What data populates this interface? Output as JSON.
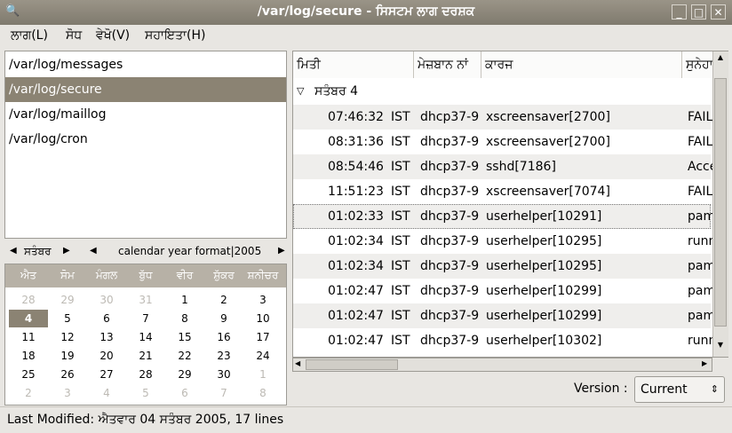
{
  "window": {
    "title": "/var/log/secure - ਸਿਸਟਮ ਲਾਗ ਦਰਸ਼ਕ"
  },
  "menu": [
    "ਲਾਗ(L)",
    "ਸੋਧ",
    "ਵੇਖੋ(V)",
    "ਸਹਾਇਤਾ(H)"
  ],
  "logs": [
    "/var/log/messages",
    "/var/log/secure",
    "/var/log/maillog",
    "/var/log/cron"
  ],
  "selected_log": "/var/log/secure",
  "calendar": {
    "month": "ਸਤੰਬਰ",
    "year": "calendar year format|2005",
    "weekdays": [
      "ਐਤ",
      "ਸੋਮ",
      "ਮੰਗਲ",
      "ਬੁੱਧ",
      "ਵੀਰ",
      "ਸ਼ੁੱਕਰ",
      "ਸ਼ਨੀਚਰ"
    ],
    "weeks": [
      [
        "28",
        "29",
        "30",
        "31",
        "1",
        "2",
        "3"
      ],
      [
        "4",
        "5",
        "6",
        "7",
        "8",
        "9",
        "10"
      ],
      [
        "11",
        "12",
        "13",
        "14",
        "15",
        "16",
        "17"
      ],
      [
        "18",
        "19",
        "20",
        "21",
        "22",
        "23",
        "24"
      ],
      [
        "25",
        "26",
        "27",
        "28",
        "29",
        "30",
        "1"
      ],
      [
        "2",
        "3",
        "4",
        "5",
        "6",
        "7",
        "8"
      ]
    ],
    "selected_day": "4"
  },
  "columns": [
    "ਮਿਤੀ",
    "ਮੇਜ਼ਬਾਨ ਨਾਂ",
    "ਕਾਰਜ",
    "ਸੁਨੇਹਾ"
  ],
  "group_label": "ਸਤੰਬਰ 4",
  "entries": [
    {
      "time": "07:46:32",
      "tz": "IST",
      "host": "dhcp37-9",
      "process": "xscreensaver[2700]",
      "message": "FAILED LOGIN"
    },
    {
      "time": "08:31:36",
      "tz": "IST",
      "host": "dhcp37-9",
      "process": "xscreensaver[2700]",
      "message": "FAILED LOGIN"
    },
    {
      "time": "08:54:46",
      "tz": "IST",
      "host": "dhcp37-9",
      "process": "sshd[7186]",
      "message": "Accepted"
    },
    {
      "time": "11:51:23",
      "tz": "IST",
      "host": "dhcp37-9",
      "process": "xscreensaver[7074]",
      "message": "FAILED LOGIN"
    },
    {
      "time": "01:02:33",
      "tz": "IST",
      "host": "dhcp37-9",
      "process": "userhelper[10291]",
      "message": "pam_timestamp"
    },
    {
      "time": "01:02:34",
      "tz": "IST",
      "host": "dhcp37-9",
      "process": "userhelper[10295]",
      "message": "running"
    },
    {
      "time": "01:02:34",
      "tz": "IST",
      "host": "dhcp37-9",
      "process": "userhelper[10295]",
      "message": "pam_timestamp"
    },
    {
      "time": "01:02:47",
      "tz": "IST",
      "host": "dhcp37-9",
      "process": "userhelper[10299]",
      "message": "pam_timestamp"
    },
    {
      "time": "01:02:47",
      "tz": "IST",
      "host": "dhcp37-9",
      "process": "userhelper[10299]",
      "message": "pam_timestamp"
    },
    {
      "time": "01:02:47",
      "tz": "IST",
      "host": "dhcp37-9",
      "process": "userhelper[10302]",
      "message": "running"
    }
  ],
  "version_label": "Version :",
  "version_value": "Current",
  "status": "Last Modified: ਐਤਵਾਰ 04 ਸਤੰਬਰ 2005, 17 lines"
}
